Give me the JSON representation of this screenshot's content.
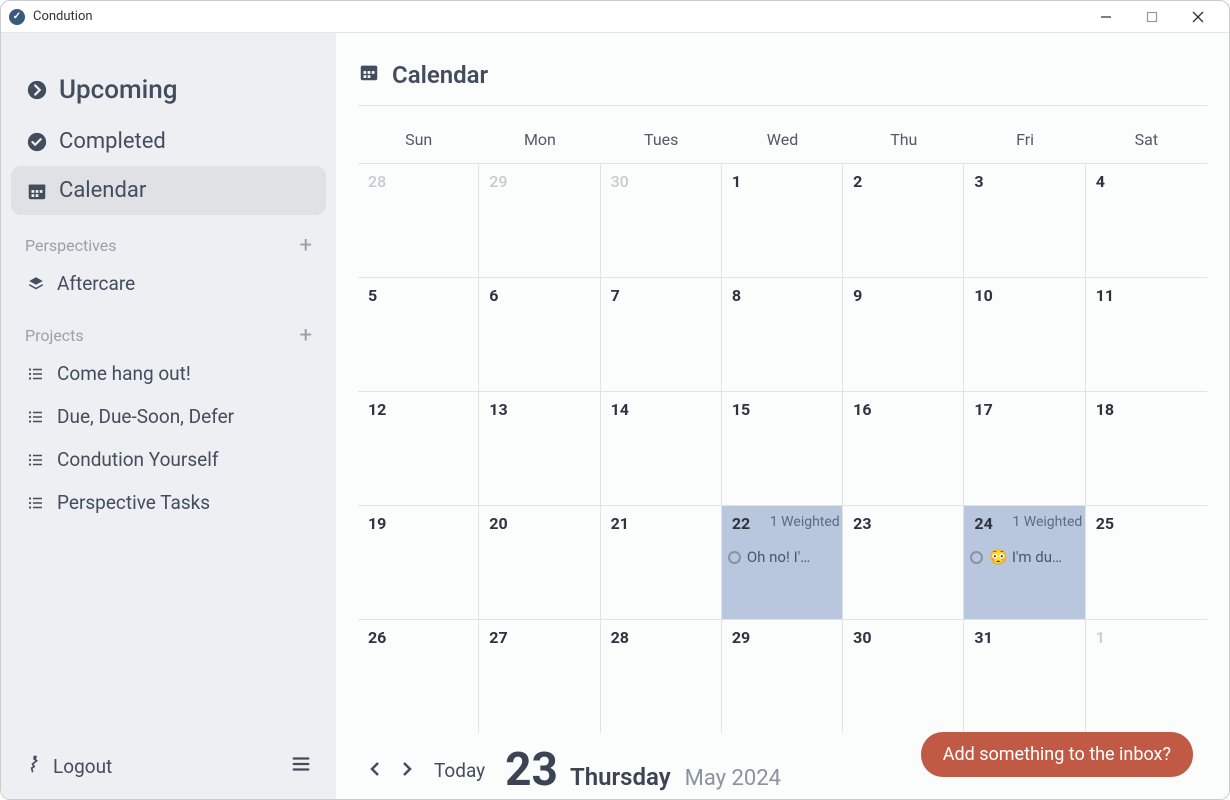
{
  "titlebar": {
    "title": "Condution"
  },
  "sidebar": {
    "upcoming": "Upcoming",
    "completed": "Completed",
    "calendar": "Calendar",
    "perspectives_label": "Perspectives",
    "perspectives": [
      {
        "label": "Aftercare"
      }
    ],
    "projects_label": "Projects",
    "projects": [
      {
        "label": "Come hang out!"
      },
      {
        "label": "Due, Due-Soon, Defer"
      },
      {
        "label": "Condution Yourself"
      },
      {
        "label": "Perspective Tasks"
      }
    ],
    "logout": "Logout"
  },
  "page": {
    "title": "Calendar"
  },
  "calendar": {
    "dow": [
      "Sun",
      "Mon",
      "Tues",
      "Wed",
      "Thu",
      "Fri",
      "Sat"
    ],
    "cells": [
      {
        "n": "28",
        "prev": true
      },
      {
        "n": "29",
        "prev": true
      },
      {
        "n": "30",
        "prev": true
      },
      {
        "n": "1"
      },
      {
        "n": "2"
      },
      {
        "n": "3"
      },
      {
        "n": "4"
      },
      {
        "n": "5"
      },
      {
        "n": "6"
      },
      {
        "n": "7"
      },
      {
        "n": "8"
      },
      {
        "n": "9"
      },
      {
        "n": "10"
      },
      {
        "n": "11"
      },
      {
        "n": "12"
      },
      {
        "n": "13"
      },
      {
        "n": "14"
      },
      {
        "n": "15"
      },
      {
        "n": "16"
      },
      {
        "n": "17"
      },
      {
        "n": "18"
      },
      {
        "n": "19"
      },
      {
        "n": "20"
      },
      {
        "n": "21"
      },
      {
        "n": "22",
        "event": true,
        "badge": "1 Weighted",
        "task": "Oh no! I'…"
      },
      {
        "n": "23"
      },
      {
        "n": "24",
        "event": true,
        "badge": "1 Weighted",
        "task": "😳 I'm du…"
      },
      {
        "n": "25"
      },
      {
        "n": "26"
      },
      {
        "n": "27"
      },
      {
        "n": "28"
      },
      {
        "n": "29"
      },
      {
        "n": "30"
      },
      {
        "n": "31"
      },
      {
        "n": "1",
        "next": true
      }
    ]
  },
  "footer": {
    "today": "Today",
    "daynum": "23",
    "dayname": "Thursday",
    "month": "May 2024"
  },
  "inbox": {
    "label": "Add something to the inbox?"
  }
}
